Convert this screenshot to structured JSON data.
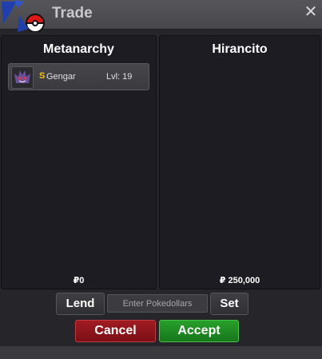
{
  "window": {
    "title": "Trade",
    "close_glyph": "✕"
  },
  "left_panel": {
    "player": "Metanarchy",
    "money": "₽0",
    "items": [
      {
        "shiny_mark": "S",
        "name": "Gengar",
        "level": "Lvl: 19",
        "icon": "gengar-sprite-icon"
      }
    ]
  },
  "right_panel": {
    "player": "Hirancito",
    "money": "₽ 250,000"
  },
  "controls": {
    "lend_label": "Lend",
    "pokedollar_placeholder": "Enter Pokedollars",
    "set_label": "Set",
    "cancel_label": "Cancel",
    "accept_label": "Accept"
  },
  "colors": {
    "cancel": "#8e1419",
    "accept": "#1f8a22",
    "shiny": "#f2c21a"
  }
}
